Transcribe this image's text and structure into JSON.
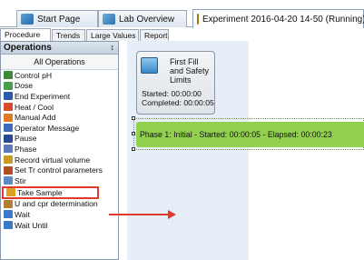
{
  "doc_tabs": [
    {
      "label": "Start Page",
      "icon": "home-icon"
    },
    {
      "label": "Lab Overview",
      "icon": "lab-icon"
    },
    {
      "label": "Experiment 2016-04-20 14-50 (Running)",
      "icon": "experiment-icon"
    }
  ],
  "sub_tabs": [
    "Procedure",
    "Trends",
    "Large Values",
    "Report"
  ],
  "operations": {
    "title": "Operations",
    "all_label": "All Operations",
    "items": [
      {
        "label": "Control pH",
        "color": "#3a8a3a"
      },
      {
        "label": "Dose",
        "color": "#4aa04a"
      },
      {
        "label": "End Experiment",
        "color": "#2a5aa8"
      },
      {
        "label": "Heat / Cool",
        "color": "#d84a2a"
      },
      {
        "label": "Manual Add",
        "color": "#e07a20"
      },
      {
        "label": "Operator Message",
        "color": "#3a6ab8"
      },
      {
        "label": "Pause",
        "color": "#2a4a98"
      },
      {
        "label": "Phase",
        "color": "#5a7ab8"
      },
      {
        "label": "Record virtual volume",
        "color": "#c89a20"
      },
      {
        "label": "Set Tr control parameters",
        "color": "#b05020"
      },
      {
        "label": "Stir",
        "color": "#5a8ac8"
      },
      {
        "label": "Take Sample",
        "color": "#e0a020"
      },
      {
        "label": "U and cpr determination",
        "color": "#b08030"
      },
      {
        "label": "Wait",
        "color": "#3a7ac8"
      },
      {
        "label": "Wait Until",
        "color": "#3a7ac8"
      }
    ]
  },
  "first_fill": {
    "title": "First Fill and Safety Limits",
    "started": "Started: 00:00:00",
    "completed": "Completed: 00:00:05"
  },
  "phase1": {
    "text": "Phase 1: Initial - Started: 00:00:05 - Elapsed: 00:00:23"
  },
  "colors": {
    "phase_green": "#92d050",
    "highlight_red": "#e03a2e"
  }
}
